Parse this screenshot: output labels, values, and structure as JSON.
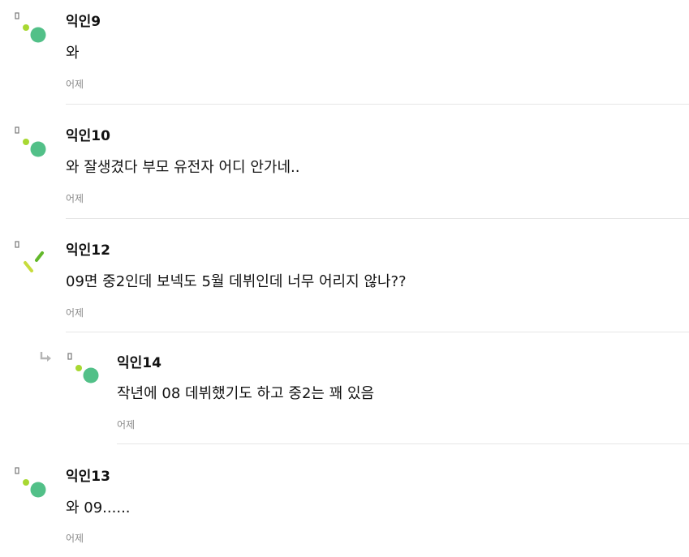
{
  "comments": [
    {
      "author": "익인9",
      "text": "와",
      "time": "어제",
      "avatar_color": "#52c088",
      "accent": "#a8d832"
    },
    {
      "author": "익인10",
      "text": "와 잘생겼다 부모 유전자 어디 안가네..",
      "time": "어제",
      "avatar_color": "#52c088",
      "accent": "#a8d832"
    },
    {
      "author": "익인12",
      "text": "09면 중2인데 보넥도 5월 데뷔인데 너무 어리지 않나??",
      "time": "어제",
      "avatar_color": "#c7dc3c",
      "accent": "#62b82a"
    },
    {
      "author": "익인14",
      "text": "작년에 08 데뷔했기도 하고 중2는 꽤 있음",
      "time": "어제",
      "reply": true,
      "avatar_color": "#52c088",
      "accent": "#a8d832"
    },
    {
      "author": "익인13",
      "text": "와 09......",
      "time": "어제",
      "avatar_color": "#52c088",
      "accent": "#a8d832"
    }
  ],
  "icons": {
    "reply": "reply-arrow-icon",
    "avatar": "avatar-icon"
  }
}
